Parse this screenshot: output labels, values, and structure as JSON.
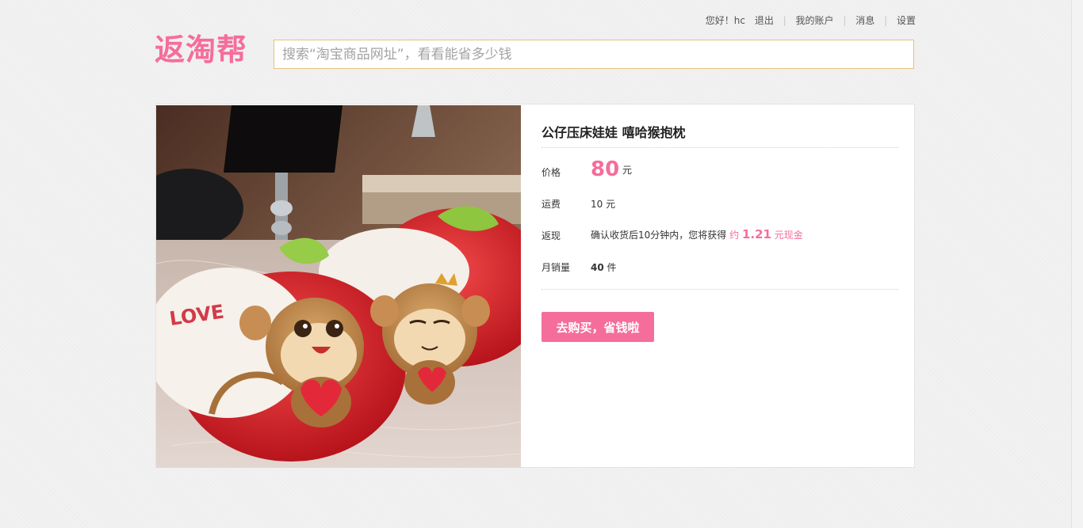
{
  "header": {
    "greeting": "您好！hc",
    "nav": [
      "退出",
      "我的账户",
      "消息",
      "设置"
    ],
    "logo_text": "返淘帮"
  },
  "search": {
    "placeholder": "搜索“淘宝商品网址”，看看能省多少钱"
  },
  "product": {
    "title": "公仔压床娃娃 嘻哈猴抱枕",
    "price_label": "价格",
    "price_value": "80",
    "price_unit": "元",
    "shipping_label": "运费",
    "shipping_value": "10 元",
    "cashback_label": "返现",
    "cashback_prefix": "确认收货后10分钟内，您将获得",
    "cashback_about": "约",
    "cashback_amount": "1.21",
    "cashback_suffix": "元现金",
    "sales_label": "月销量",
    "sales_value": "40",
    "sales_unit": "件",
    "buy_label": "去购买，省钱啦",
    "image_text": "LOVE"
  },
  "colors": {
    "accent": "#f56d9b",
    "search_border": "#e8c07c"
  }
}
